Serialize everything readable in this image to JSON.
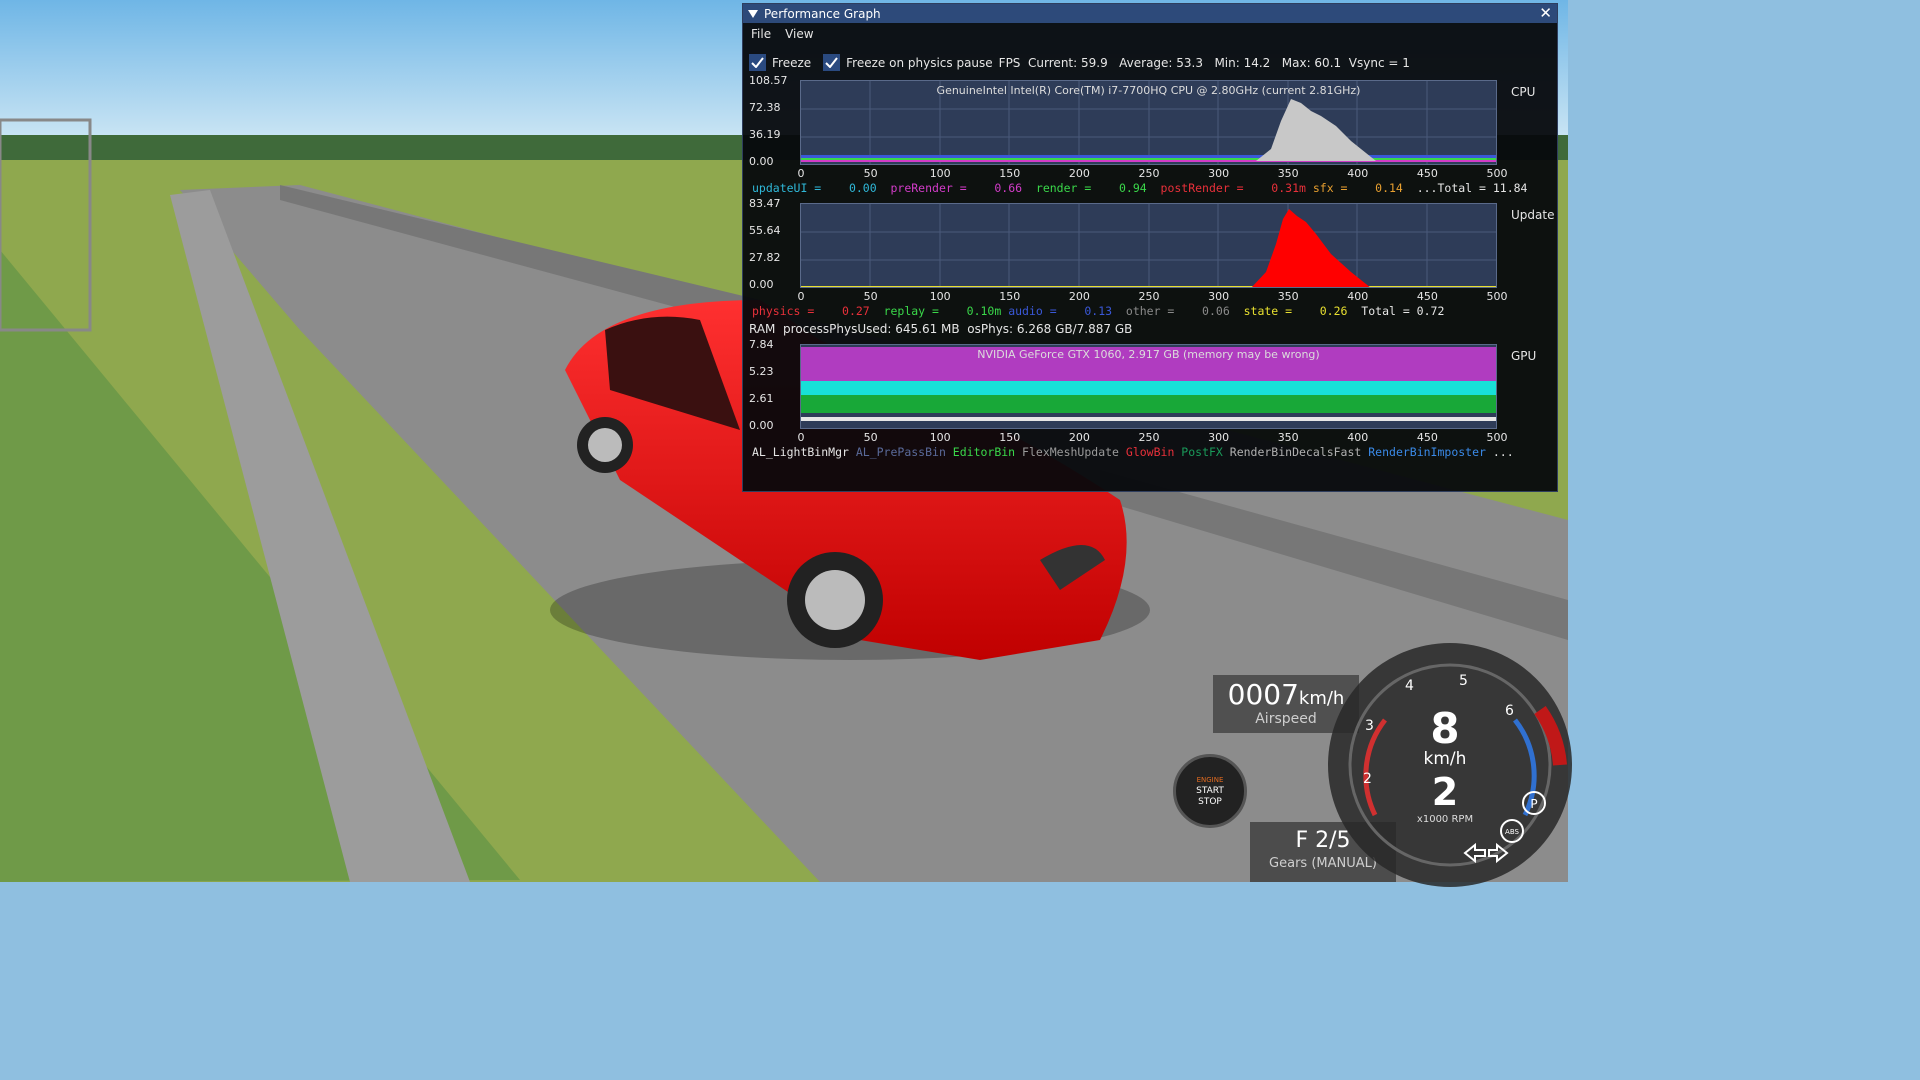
{
  "window": {
    "title": "Performance Graph",
    "close_glyph": "✕",
    "menu": [
      "File",
      "View"
    ]
  },
  "options": {
    "freeze_label": "Freeze",
    "freeze_checked": true,
    "freeze_physics_label": "Freeze on physics pause",
    "freeze_physics_checked": true,
    "fps_text": "FPS  Current: 59.9   Average: 53.3   Min: 14.2   Max: 60.1  Vsync = 1"
  },
  "cpu": {
    "side_label": "CPU",
    "title": "GenuineIntel Intel(R) Core(TM) i7-7700HQ CPU @ 2.80GHz (current 2.81GHz)",
    "y_labels": [
      "108.57",
      "72.38",
      "36.19",
      "0.00"
    ],
    "stats": [
      {
        "text": "updateUI = ",
        "color": "#2fb8d8"
      },
      {
        "text": "   0.00  ",
        "color": "#2fb8d8"
      },
      {
        "text": "preRender = ",
        "color": "#d23cc8"
      },
      {
        "text": "   0.66  ",
        "color": "#d23cc8"
      },
      {
        "text": "render = ",
        "color": "#3ad84a"
      },
      {
        "text": "   0.94  ",
        "color": "#3ad84a"
      },
      {
        "text": "postRender = ",
        "color": "#e8303a"
      },
      {
        "text": "   0.31m ",
        "color": "#e8303a"
      },
      {
        "text": "sfx = ",
        "color": "#e8a030"
      },
      {
        "text": "   0.14  ",
        "color": "#e8a030"
      },
      {
        "text": "...Total = 11.84",
        "color": "#e6e6e6"
      }
    ]
  },
  "update": {
    "side_label": "Update",
    "y_labels": [
      "83.47",
      "55.64",
      "27.82",
      "0.00"
    ],
    "stats": [
      {
        "text": "physics = ",
        "color": "#e8303a"
      },
      {
        "text": "   0.27  ",
        "color": "#e8303a"
      },
      {
        "text": "replay = ",
        "color": "#3ad84a"
      },
      {
        "text": "   0.10m ",
        "color": "#3ad84a"
      },
      {
        "text": "audio = ",
        "color": "#3a58d8"
      },
      {
        "text": "   0.13  ",
        "color": "#3a58d8"
      },
      {
        "text": "other = ",
        "color": "#8a8a8a"
      },
      {
        "text": "   0.06  ",
        "color": "#8a8a8a"
      },
      {
        "text": "state = ",
        "color": "#e8e030"
      },
      {
        "text": "   0.26  ",
        "color": "#e8e030"
      },
      {
        "text": "Total = 0.72",
        "color": "#e6e6e6"
      }
    ]
  },
  "ram": {
    "text": "RAM  processPhysUsed: 645.61 MB  osPhys: 6.268 GB/7.887 GB"
  },
  "gpu": {
    "side_label": "GPU",
    "title": "NVIDIA GeForce GTX 1060, 2.917 GB (memory may be wrong)",
    "y_labels": [
      "7.84",
      "5.23",
      "2.61",
      "0.00"
    ],
    "stats": [
      {
        "text": "AL_LightBinMgr ",
        "color": "#e6e6e6"
      },
      {
        "text": "AL_PrePassBin ",
        "color": "#5a6a9a"
      },
      {
        "text": "EditorBin ",
        "color": "#3ad84a"
      },
      {
        "text": "FlexMeshUpdate ",
        "color": "#9a9a9a"
      },
      {
        "text": "GlowBin ",
        "color": "#e8303a"
      },
      {
        "text": "PostFX ",
        "color": "#1a9a5a"
      },
      {
        "text": "RenderBinDecalsFast ",
        "color": "#b0b0b0"
      },
      {
        "text": "RenderBinImposter ",
        "color": "#3a8ae8"
      },
      {
        "text": "...",
        "color": "#e6e6e6"
      }
    ]
  },
  "x_ticks": [
    "0",
    "50",
    "100",
    "150",
    "200",
    "250",
    "300",
    "350",
    "400",
    "450",
    "500"
  ],
  "hud": {
    "airspeed_value": "0007",
    "airspeed_unit": "km/h",
    "airspeed_label": "Airspeed",
    "engine": [
      "ENGINE",
      "START",
      "STOP"
    ],
    "gear_value": "F 2/5",
    "gear_label": "Gears (MANUAL)",
    "gauge_speed": "8",
    "gauge_unit": "km/h",
    "gauge_gear": "2",
    "gauge_rpm_label": "x1000 RPM",
    "gauge_ticks": [
      "2",
      "3",
      "4",
      "5",
      "6"
    ],
    "park_label": "P",
    "abs_label": "ABS"
  }
}
